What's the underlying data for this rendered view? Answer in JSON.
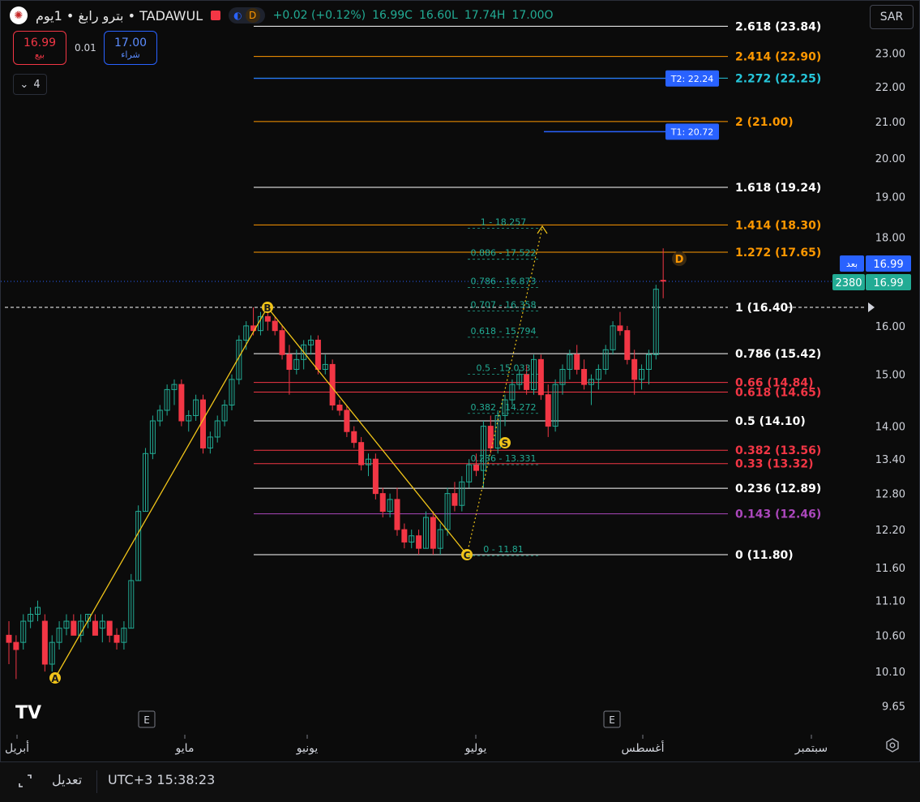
{
  "header": {
    "logo_glyph": "✺",
    "title": "بترو رابغ • 1يوم • TADAWUL",
    "change": "+0.02 (+0.12%)",
    "close": "16.99C",
    "low": "16.60L",
    "high": "17.74H",
    "open": "17.00O",
    "session_icon": "moon-icon",
    "d_badge": "D"
  },
  "trade": {
    "sell_price": "16.99",
    "sell_label": "بيع",
    "spread": "0.01",
    "buy_price": "17.00",
    "buy_label": "شراء",
    "collapse_count": "4"
  },
  "currency": "SAR",
  "fib_levels": [
    {
      "label": "2.618 (23.84)",
      "value": 23.84,
      "color": "#ffffff"
    },
    {
      "label": "2.414 (22.90)",
      "value": 22.9,
      "color": "#ff9800"
    },
    {
      "label": "2.272 (22.25)",
      "value": 22.25,
      "color": "#26c6da"
    },
    {
      "label": "2 (21.00)",
      "value": 21.0,
      "color": "#ff9800"
    },
    {
      "label": "1.618 (19.24)",
      "value": 19.24,
      "color": "#ffffff"
    },
    {
      "label": "1.414 (18.30)",
      "value": 18.3,
      "color": "#ff9800"
    },
    {
      "label": "1.272 (17.65)",
      "value": 17.65,
      "color": "#ff9800"
    },
    {
      "label": "1 (16.40)",
      "value": 16.4,
      "color": "#ffffff"
    },
    {
      "label": "0.786 (15.42)",
      "value": 15.42,
      "color": "#ffffff"
    },
    {
      "label": "0.66 (14.84)",
      "value": 14.84,
      "color": "#f23645"
    },
    {
      "label": "0.618 (14.65)",
      "value": 14.65,
      "color": "#f23645"
    },
    {
      "label": "0.5 (14.10)",
      "value": 14.1,
      "color": "#ffffff"
    },
    {
      "label": "0.382 (13.56)",
      "value": 13.56,
      "color": "#f23645"
    },
    {
      "label": "0.33 (13.32)",
      "value": 13.32,
      "color": "#f23645"
    },
    {
      "label": "0.236 (12.89)",
      "value": 12.89,
      "color": "#ffffff"
    },
    {
      "label": "0.143 (12.46)",
      "value": 12.46,
      "color": "#ab47bc"
    },
    {
      "label": "0 (11.80)",
      "value": 11.8,
      "color": "#ffffff"
    }
  ],
  "retrace_labels": [
    {
      "label": "1 - 18.257",
      "value": 18.257
    },
    {
      "label": "0.886 - 17.522",
      "value": 17.522
    },
    {
      "label": "0.786 - 16.873",
      "value": 16.873
    },
    {
      "label": "0.707 - 16.358",
      "value": 16.358
    },
    {
      "label": "0.618 - 15.794",
      "value": 15.794
    },
    {
      "label": "0.5 - 15.033",
      "value": 15.033
    },
    {
      "label": "0.382 - 14.272",
      "value": 14.272
    },
    {
      "label": "0.236 - 13.331",
      "value": 13.331
    },
    {
      "label": "0 - 11.81",
      "value": 11.81
    }
  ],
  "targets": [
    {
      "label": "T2: 22.24",
      "value": 22.24
    },
    {
      "label": "T1: 20.72",
      "value": 20.72
    }
  ],
  "price_axis": {
    "ticks": [
      "23.00",
      "22.00",
      "21.00",
      "20.00",
      "19.00",
      "18.00",
      "16.00",
      "15.00",
      "14.00",
      "13.40",
      "12.80",
      "12.20",
      "11.60",
      "11.10",
      "10.60",
      "10.10",
      "9.65"
    ],
    "countdown_label": "بعد",
    "last_price": "16.99",
    "volume_label": "2380",
    "volume_price": "16.99"
  },
  "time_axis": [
    "أبريل",
    "مايو",
    "يونيو",
    "يوليو",
    "أغسطس",
    "سبتمبر"
  ],
  "pattern_points": [
    "A",
    "B",
    "C",
    "D",
    "S"
  ],
  "earnings_marker": "E",
  "colors": {
    "up": "#22ab94",
    "down": "#f23645",
    "pattern": "#f0c419",
    "target": "#2962ff"
  },
  "bottom_bar": {
    "edit_label": "تعديل",
    "timezone": "UTC+3 15:38:23"
  },
  "chart_data": {
    "type": "candlestick",
    "symbol": "بترو رابغ",
    "exchange": "TADAWUL",
    "interval": "1D",
    "candles": [
      {
        "o": 10.6,
        "h": 10.8,
        "l": 10.2,
        "c": 10.5
      },
      {
        "o": 10.5,
        "h": 10.6,
        "l": 10.0,
        "c": 10.4
      },
      {
        "o": 10.5,
        "h": 10.9,
        "l": 10.4,
        "c": 10.8
      },
      {
        "o": 10.8,
        "h": 11.0,
        "l": 10.7,
        "c": 10.9
      },
      {
        "o": 10.9,
        "h": 11.1,
        "l": 10.8,
        "c": 11.0
      },
      {
        "o": 10.8,
        "h": 10.9,
        "l": 10.1,
        "c": 10.2
      },
      {
        "o": 10.2,
        "h": 10.6,
        "l": 10.1,
        "c": 10.5
      },
      {
        "o": 10.5,
        "h": 10.8,
        "l": 10.4,
        "c": 10.7
      },
      {
        "o": 10.7,
        "h": 10.9,
        "l": 10.6,
        "c": 10.8
      },
      {
        "o": 10.8,
        "h": 10.9,
        "l": 10.6,
        "c": 10.6
      },
      {
        "o": 10.6,
        "h": 10.9,
        "l": 10.5,
        "c": 10.8
      },
      {
        "o": 10.8,
        "h": 10.9,
        "l": 10.7,
        "c": 10.9
      },
      {
        "o": 10.8,
        "h": 10.9,
        "l": 10.6,
        "c": 10.6
      },
      {
        "o": 10.7,
        "h": 10.9,
        "l": 10.5,
        "c": 10.8
      },
      {
        "o": 10.8,
        "h": 10.8,
        "l": 10.5,
        "c": 10.6
      },
      {
        "o": 10.6,
        "h": 10.7,
        "l": 10.4,
        "c": 10.5
      },
      {
        "o": 10.5,
        "h": 10.8,
        "l": 10.4,
        "c": 10.7
      },
      {
        "o": 10.7,
        "h": 11.5,
        "l": 10.7,
        "c": 11.4
      },
      {
        "o": 11.4,
        "h": 12.6,
        "l": 11.4,
        "c": 12.5
      },
      {
        "o": 12.5,
        "h": 13.6,
        "l": 12.5,
        "c": 13.5
      },
      {
        "o": 13.5,
        "h": 14.2,
        "l": 13.4,
        "c": 14.1
      },
      {
        "o": 14.1,
        "h": 14.4,
        "l": 14.0,
        "c": 14.3
      },
      {
        "o": 14.3,
        "h": 14.8,
        "l": 14.2,
        "c": 14.7
      },
      {
        "o": 14.7,
        "h": 14.9,
        "l": 14.4,
        "c": 14.8
      },
      {
        "o": 14.8,
        "h": 14.9,
        "l": 14.0,
        "c": 14.1
      },
      {
        "o": 14.1,
        "h": 14.3,
        "l": 13.9,
        "c": 14.2
      },
      {
        "o": 14.2,
        "h": 14.6,
        "l": 14.1,
        "c": 14.5
      },
      {
        "o": 14.5,
        "h": 14.6,
        "l": 13.5,
        "c": 13.6
      },
      {
        "o": 13.6,
        "h": 13.9,
        "l": 13.5,
        "c": 13.8
      },
      {
        "o": 13.8,
        "h": 14.2,
        "l": 13.7,
        "c": 14.1
      },
      {
        "o": 14.1,
        "h": 14.5,
        "l": 14.0,
        "c": 14.4
      },
      {
        "o": 14.4,
        "h": 15.0,
        "l": 14.3,
        "c": 14.9
      },
      {
        "o": 14.9,
        "h": 15.8,
        "l": 14.8,
        "c": 15.7
      },
      {
        "o": 15.7,
        "h": 16.1,
        "l": 15.5,
        "c": 16.0
      },
      {
        "o": 16.0,
        "h": 16.4,
        "l": 15.8,
        "c": 15.9
      },
      {
        "o": 15.9,
        "h": 16.3,
        "l": 15.8,
        "c": 16.2
      },
      {
        "o": 16.2,
        "h": 16.3,
        "l": 15.9,
        "c": 16.1
      },
      {
        "o": 16.1,
        "h": 16.2,
        "l": 15.8,
        "c": 15.9
      },
      {
        "o": 15.9,
        "h": 16.0,
        "l": 15.3,
        "c": 15.4
      },
      {
        "o": 15.4,
        "h": 15.6,
        "l": 14.6,
        "c": 15.1
      },
      {
        "o": 15.1,
        "h": 15.5,
        "l": 15.0,
        "c": 15.3
      },
      {
        "o": 15.3,
        "h": 15.7,
        "l": 15.1,
        "c": 15.6
      },
      {
        "o": 15.6,
        "h": 15.8,
        "l": 15.4,
        "c": 15.7
      },
      {
        "o": 15.7,
        "h": 15.8,
        "l": 15.0,
        "c": 15.1
      },
      {
        "o": 15.1,
        "h": 15.4,
        "l": 15.0,
        "c": 15.2
      },
      {
        "o": 15.2,
        "h": 15.3,
        "l": 14.3,
        "c": 14.4
      },
      {
        "o": 14.4,
        "h": 14.5,
        "l": 14.2,
        "c": 14.3
      },
      {
        "o": 14.3,
        "h": 14.4,
        "l": 13.8,
        "c": 13.9
      },
      {
        "o": 13.9,
        "h": 14.0,
        "l": 13.6,
        "c": 13.7
      },
      {
        "o": 13.7,
        "h": 13.8,
        "l": 13.2,
        "c": 13.3
      },
      {
        "o": 13.3,
        "h": 13.5,
        "l": 13.1,
        "c": 13.4
      },
      {
        "o": 13.4,
        "h": 13.5,
        "l": 12.7,
        "c": 12.8
      },
      {
        "o": 12.8,
        "h": 12.9,
        "l": 12.4,
        "c": 12.5
      },
      {
        "o": 12.5,
        "h": 12.8,
        "l": 12.4,
        "c": 12.7
      },
      {
        "o": 12.7,
        "h": 12.9,
        "l": 12.1,
        "c": 12.2
      },
      {
        "o": 12.2,
        "h": 12.3,
        "l": 11.9,
        "c": 12.0
      },
      {
        "o": 12.0,
        "h": 12.2,
        "l": 11.9,
        "c": 12.1
      },
      {
        "o": 12.1,
        "h": 12.2,
        "l": 11.8,
        "c": 11.9
      },
      {
        "o": 11.9,
        "h": 12.5,
        "l": 11.9,
        "c": 12.4
      },
      {
        "o": 12.4,
        "h": 12.5,
        "l": 11.8,
        "c": 11.9
      },
      {
        "o": 11.9,
        "h": 12.3,
        "l": 11.8,
        "c": 12.2
      },
      {
        "o": 12.2,
        "h": 12.9,
        "l": 12.1,
        "c": 12.8
      },
      {
        "o": 12.8,
        "h": 13.0,
        "l": 12.5,
        "c": 12.6
      },
      {
        "o": 12.6,
        "h": 13.1,
        "l": 12.5,
        "c": 13.0
      },
      {
        "o": 13.0,
        "h": 13.4,
        "l": 12.9,
        "c": 13.3
      },
      {
        "o": 13.3,
        "h": 13.5,
        "l": 13.1,
        "c": 13.2
      },
      {
        "o": 13.2,
        "h": 14.1,
        "l": 12.9,
        "c": 14.0
      },
      {
        "o": 14.0,
        "h": 14.2,
        "l": 13.5,
        "c": 13.6
      },
      {
        "o": 13.6,
        "h": 14.3,
        "l": 13.5,
        "c": 14.2
      },
      {
        "o": 14.2,
        "h": 14.6,
        "l": 14.0,
        "c": 14.5
      },
      {
        "o": 14.5,
        "h": 14.9,
        "l": 14.4,
        "c": 14.8
      },
      {
        "o": 14.8,
        "h": 15.1,
        "l": 14.7,
        "c": 15.0
      },
      {
        "o": 15.0,
        "h": 15.2,
        "l": 14.6,
        "c": 14.7
      },
      {
        "o": 14.7,
        "h": 15.4,
        "l": 14.6,
        "c": 15.3
      },
      {
        "o": 15.3,
        "h": 15.4,
        "l": 14.5,
        "c": 14.6
      },
      {
        "o": 14.6,
        "h": 14.8,
        "l": 13.8,
        "c": 14.0
      },
      {
        "o": 14.0,
        "h": 14.9,
        "l": 13.9,
        "c": 14.8
      },
      {
        "o": 14.8,
        "h": 15.2,
        "l": 14.6,
        "c": 15.1
      },
      {
        "o": 15.1,
        "h": 15.5,
        "l": 14.9,
        "c": 15.4
      },
      {
        "o": 15.4,
        "h": 15.6,
        "l": 15.0,
        "c": 15.1
      },
      {
        "o": 15.1,
        "h": 15.3,
        "l": 14.7,
        "c": 14.8
      },
      {
        "o": 14.8,
        "h": 15.0,
        "l": 14.4,
        "c": 14.9
      },
      {
        "o": 14.9,
        "h": 15.2,
        "l": 14.7,
        "c": 15.1
      },
      {
        "o": 15.1,
        "h": 15.6,
        "l": 15.0,
        "c": 15.5
      },
      {
        "o": 15.5,
        "h": 16.1,
        "l": 15.4,
        "c": 16.0
      },
      {
        "o": 16.0,
        "h": 16.3,
        "l": 15.8,
        "c": 15.9
      },
      {
        "o": 15.9,
        "h": 16.0,
        "l": 15.2,
        "c": 15.3
      },
      {
        "o": 15.3,
        "h": 15.5,
        "l": 14.6,
        "c": 14.9
      },
      {
        "o": 14.9,
        "h": 15.2,
        "l": 14.7,
        "c": 15.1
      },
      {
        "o": 15.1,
        "h": 15.5,
        "l": 14.8,
        "c": 15.4
      },
      {
        "o": 15.4,
        "h": 16.9,
        "l": 15.3,
        "c": 16.8
      },
      {
        "o": 17.0,
        "h": 17.74,
        "l": 16.6,
        "c": 16.99
      }
    ]
  }
}
